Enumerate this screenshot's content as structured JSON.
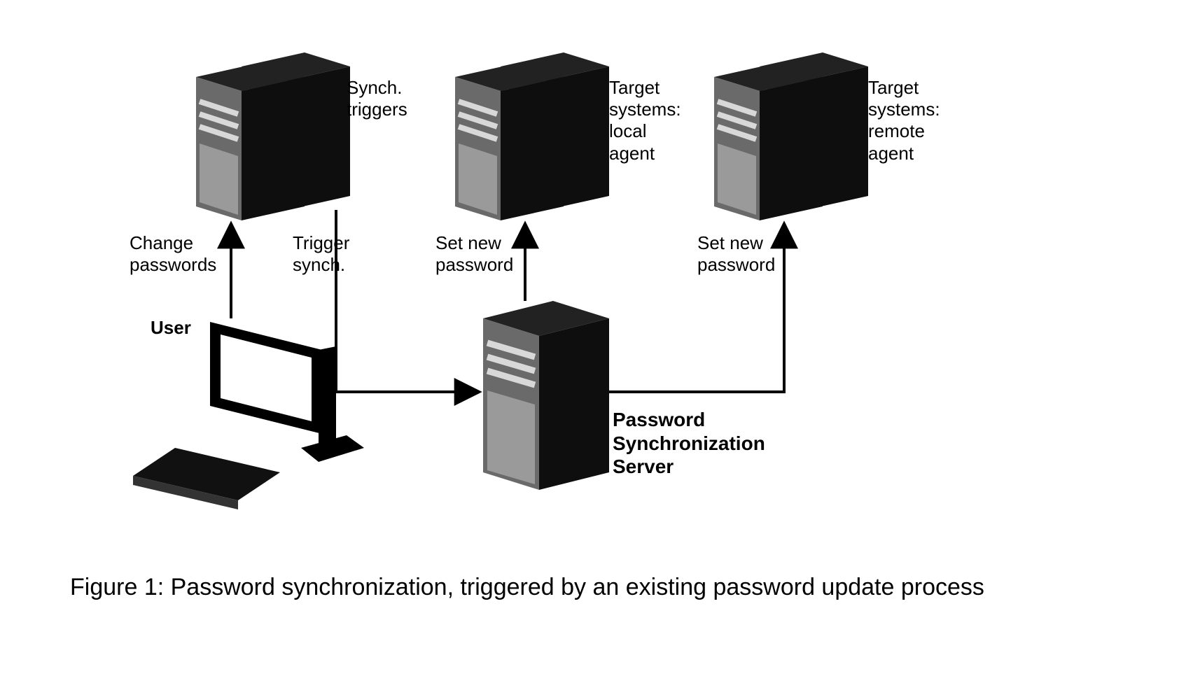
{
  "labels": {
    "user": "User",
    "change_passwords": "Change\npasswords",
    "synch_triggers": "Synch.\ntriggers",
    "trigger_synch": "Trigger\nsynch.",
    "set_new_password_1": "Set new\npassword",
    "target_local": "Target\nsystems:\nlocal\nagent",
    "set_new_password_2": "Set new\npassword",
    "target_remote": "Target\nsystems:\nremote\nagent",
    "pss": "Password\nSynchronization\nServer"
  },
  "caption": "Figure 1: Password synchronization, triggered by an existing password update process"
}
